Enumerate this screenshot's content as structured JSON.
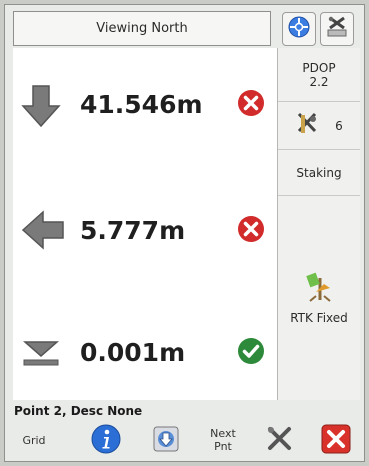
{
  "header": {
    "view_label": "Viewing North"
  },
  "top_icons": [
    "crosshair-icon",
    "satellite-settings-icon"
  ],
  "rows": [
    {
      "direction": "down",
      "value": "41.546m",
      "status": "error"
    },
    {
      "direction": "left",
      "value": "5.777m",
      "status": "error"
    },
    {
      "direction": "elevation",
      "value": "0.001m",
      "status": "ok"
    }
  ],
  "side": {
    "pdop_label": "PDOP",
    "pdop_value": "2.2",
    "satellites": "6",
    "mode": "Staking",
    "rtk_status": "RTK Fixed"
  },
  "footer": {
    "point_label": "Point 2, Desc None",
    "grid_label": "Grid",
    "next_label_1": "Next",
    "next_label_2": "Pnt"
  },
  "colors": {
    "error": "#d12b2b",
    "ok": "#2d8a3a",
    "arrow": "#777777",
    "info": "#2b6fd6"
  }
}
